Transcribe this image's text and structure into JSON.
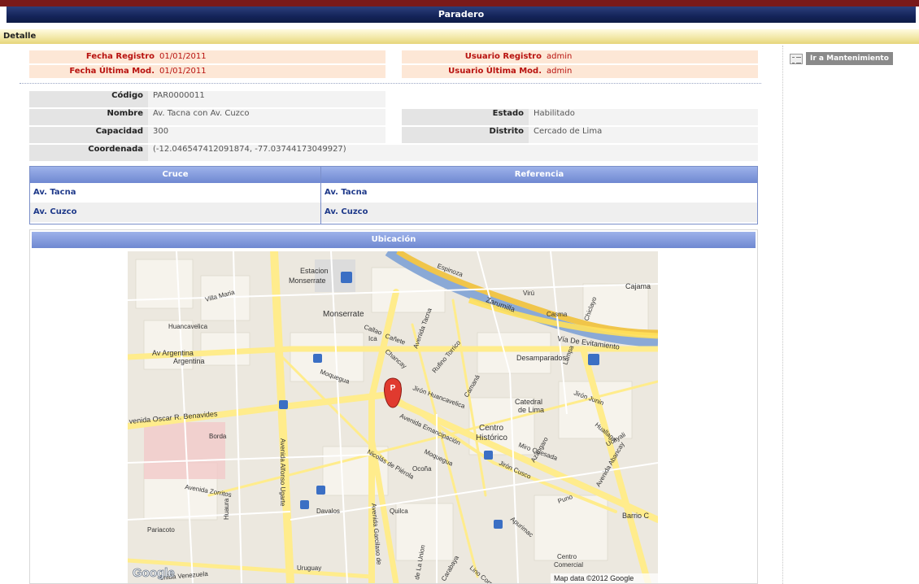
{
  "header": {
    "title": "Paradero",
    "section": "Detalle"
  },
  "side": {
    "maintenance_label": "Ir a Mantenimiento"
  },
  "audit": {
    "fecha_registro_label": "Fecha Registro",
    "fecha_registro_value": "01/01/2011",
    "fecha_ultima_mod_label": "Fecha Última Mod.",
    "fecha_ultima_mod_value": "01/01/2011",
    "usuario_registro_label": "Usuario Registro",
    "usuario_registro_value": "admin",
    "usuario_ultima_mod_label": "Usuario Última Mod.",
    "usuario_ultima_mod_value": "admin"
  },
  "details": {
    "codigo_label": "Código",
    "codigo_value": "PAR0000011",
    "nombre_label": "Nombre",
    "nombre_value": "Av. Tacna con Av. Cuzco",
    "estado_label": "Estado",
    "estado_value": "Habilitado",
    "capacidad_label": "Capacidad",
    "capacidad_value": "300",
    "distrito_label": "Distrito",
    "distrito_value": "Cercado de Lima",
    "coordenada_label": "Coordenada",
    "coordenada_value": "(-12.046547412091874, -77.03744173049927)"
  },
  "cruce_table": {
    "headers": [
      "Cruce",
      "Referencia"
    ],
    "rows": [
      [
        "Av. Tacna",
        "Av. Tacna"
      ],
      [
        "Av. Cuzco",
        "Av. Cuzco"
      ]
    ]
  },
  "location": {
    "header": "Ubicación",
    "map": {
      "marker_label": "P",
      "attribution": "Map data ©2012 Google",
      "logo": "Google",
      "labels": {
        "monserrate": "Monserrate",
        "estacion": "Estacion",
        "estacion2": "Monserrate",
        "desamparados": "Desamparados",
        "catedral": "Catedral",
        "catedral2": "de Lima",
        "centro": "Centro",
        "centro2": "Histórico",
        "zarumilla": "Zarumilla",
        "evitamiento": "Vía De Evitamiento",
        "argentina1": "Av Argentina",
        "argentina2": "Argentina",
        "benavides": "venida Oscar R. Benavides",
        "alfonso": "Avenida Alfonso Ugarte",
        "tacna": "Avenida Tacna",
        "emancipacion": "Avenida Emancipación",
        "pierola": "Nicolás de Piérola",
        "moquegua1": "Moquegua",
        "moquegua2": "Moquegua",
        "jironcusco": "Jirón Cusco",
        "huancavelica": "Huancavelica",
        "jironhuancavelica": "Jirón Huancavelica",
        "camana": "Camaná",
        "lampa": "Lampa",
        "abancay": "Avenida Abancay",
        "puno": "Puno",
        "ucayali": "Ucayali",
        "miroquesada": "Miro Quesada",
        "barrio": "Barrio C",
        "centrocomercial": "Centro",
        "centrocomercial2": "Comercial",
        "zorritos": "Avenida Zorritos",
        "venezuela": "enida Venezuela",
        "uruguay": "Uruguay",
        "quilca": "Quilca",
        "ocona": "Ocoña",
        "rufino": "Rufino Torrico",
        "callao": "Callao",
        "ica": "Ica",
        "canete": "Cañete",
        "chancay": "Chancay",
        "villamaria": "Villa Maria",
        "borda": "Borda",
        "davalos": "Davalos",
        "paracoto": "Pariacoto",
        "garcilaso": "Avenida Garcilaso de",
        "huaura": "Huaura",
        "jirojunin": "Jirón Junin",
        "huallaga": "Huallaga",
        "huanuco": "Huanuco",
        "lino": "Lino Cornejo",
        "apurimac": "Apurimac",
        "azangaro": "Azangaro",
        "carabaya": "Carabaya",
        "casma": "Casma",
        "viru": "Virú",
        "cajamarca": "Cajama",
        "delima": "de La Union",
        "espinoza": "Espinoza",
        "chiclayo": "Chiclayo"
      }
    }
  }
}
